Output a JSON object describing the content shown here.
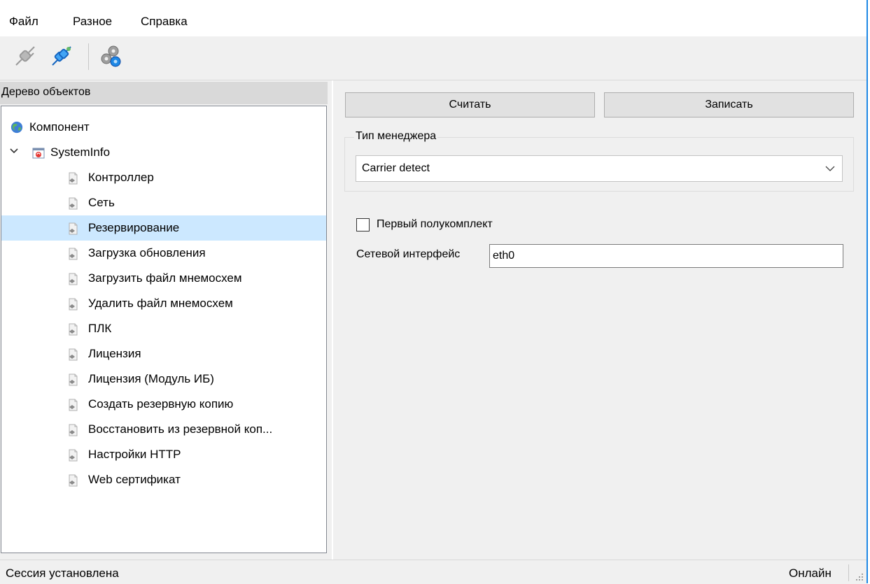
{
  "menu": {
    "file": "Файл",
    "misc": "Разное",
    "help": "Справка"
  },
  "toolbar": {
    "icons": [
      "plug-disconnected-icon",
      "plug-connected-icon",
      "gears-icon"
    ]
  },
  "tree": {
    "header": "Дерево объектов",
    "root": "Компонент",
    "node": "SystemInfo",
    "items": [
      "Контроллер",
      "Сеть",
      "Резервирование",
      "Загрузка обновления",
      "Загрузить файл мнемосхем",
      "Удалить файл мнемосхем",
      "ПЛК",
      "Лицензия",
      "Лицензия (Модуль ИБ)",
      "Создать резервную копию",
      "Восстановить из резервной коп...",
      "Настройки HTTP",
      "Web сертификат"
    ],
    "selected": "Резервирование"
  },
  "actions": {
    "read": "Считать",
    "write": "Записать"
  },
  "manager": {
    "group_title": "Тип менеджера",
    "selected": "Carrier detect"
  },
  "form": {
    "checkbox_label": "Первый полукомплект",
    "checkbox_checked": false,
    "iface_label": "Сетевой интерфейс",
    "iface_value": "eth0"
  },
  "status": {
    "left": "Сессия установлена",
    "right": "Онлайн"
  },
  "colors": {
    "selection": "#cce8ff",
    "accent_border": "#1e88e5"
  }
}
